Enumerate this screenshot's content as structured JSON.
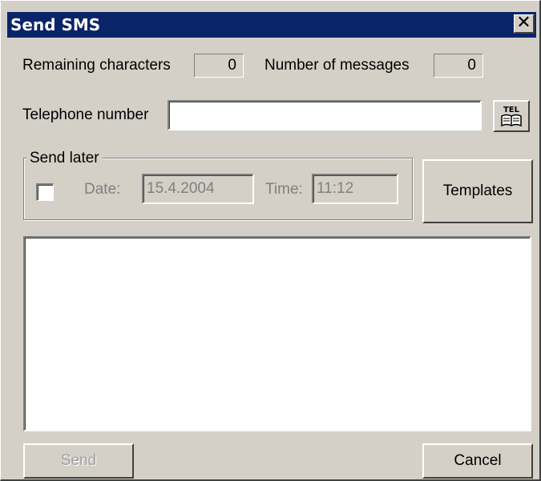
{
  "window": {
    "title": "Send SMS"
  },
  "counters": {
    "remaining_label": "Remaining characters",
    "remaining_value": "0",
    "messages_label": "Number of messages",
    "messages_value": "0"
  },
  "telephone": {
    "label": "Telephone number",
    "value": "",
    "phonebook_icon": "phonebook-icon",
    "icon_text": "TEL"
  },
  "send_later": {
    "legend": "Send later",
    "checked": false,
    "date_label": "Date:",
    "date_value": "15.4.2004",
    "time_label": "Time:",
    "time_value": "11:12"
  },
  "buttons": {
    "templates": "Templates",
    "send": "Send",
    "cancel": "Cancel",
    "close": "✕"
  },
  "message": {
    "text": ""
  },
  "colors": {
    "titlebar": "#0a246a",
    "face": "#d4d0c8",
    "disabled_text": "#808080"
  }
}
